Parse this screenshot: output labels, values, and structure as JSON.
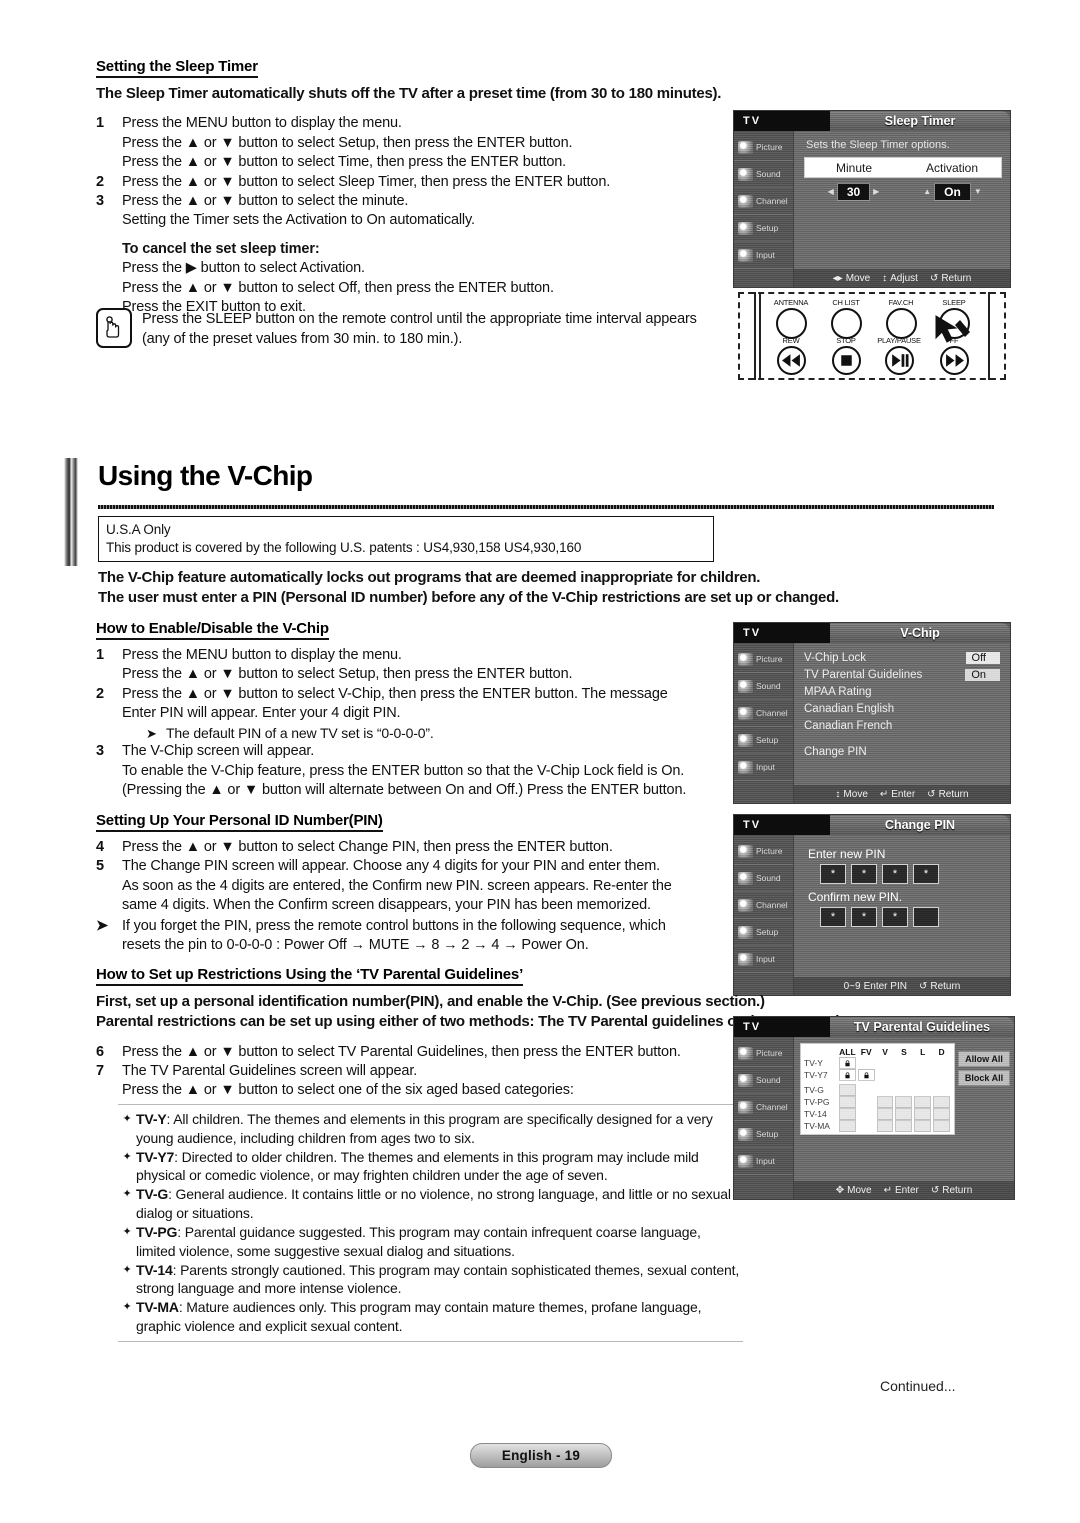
{
  "sleep_timer": {
    "heading": "Setting the Sleep Timer",
    "lead": "The Sleep Timer automatically shuts off the TV after a preset time (from 30 to 180 minutes).",
    "steps": [
      {
        "num": "1",
        "lines": [
          "Press the MENU button to display the menu.",
          "Press the ▲ or ▼ button to select Setup, then press the ENTER button.",
          "Press the ▲ or ▼ button to select Time, then press the ENTER button."
        ]
      },
      {
        "num": "2",
        "lines": [
          "Press the ▲ or ▼ button to select Sleep Timer, then press the ENTER button."
        ]
      },
      {
        "num": "3",
        "lines": [
          "Press the ▲ or ▼ button to select the minute.",
          "Setting the Timer sets the Activation to On automatically."
        ]
      }
    ],
    "cancel_heading": "To cancel the set sleep timer:",
    "cancel_lines": [
      "Press the ▶ button to select Activation.",
      "Press the ▲ or ▼ button to select Off, then press the ENTER button.",
      "Press the EXIT button to exit."
    ],
    "note_line1": "Press the SLEEP button on the remote control until the appropriate time interval appears",
    "note_line2": "(any of the preset values from 30 min. to 180 min.)."
  },
  "vchip": {
    "title": "Using the V-Chip",
    "patent_line1": "U.S.A Only",
    "patent_line2": "This product is covered by the following U.S. patents : US4,930,158 US4,930,160",
    "lead_line1": "The V-Chip feature automatically locks out programs that are deemed inappropriate for children.",
    "lead_line2": "The user must enter a PIN (Personal ID number) before any of the V-Chip restrictions are set up or changed."
  },
  "enable": {
    "heading": "How to Enable/Disable the V-Chip",
    "steps": [
      {
        "num": "1",
        "lines": [
          "Press the MENU button to display the menu.",
          "Press the ▲ or ▼ button to select Setup, then press the ENTER button."
        ]
      },
      {
        "num": "2",
        "lines": [
          "Press the ▲ or ▼ button to select V-Chip, then press the ENTER button. The message",
          "Enter PIN will appear. Enter your 4 digit PIN."
        ],
        "note": "The default PIN of a new TV set is “0-0-0-0”."
      },
      {
        "num": "3",
        "lines": [
          "The V-Chip screen will appear.",
          "To enable the V-Chip feature, press the ENTER button so that the V-Chip Lock field is On.",
          "(Pressing the ▲ or ▼ button will alternate between On and Off.) Press the ENTER button."
        ]
      }
    ]
  },
  "pin": {
    "heading": "Setting Up Your Personal ID Number(PIN)",
    "steps": [
      {
        "num": "4",
        "lines": [
          "Press the ▲ or ▼ button to select Change PIN, then press the ENTER button."
        ]
      },
      {
        "num": "5",
        "lines": [
          "The Change PIN screen will appear. Choose any 4 digits for your PIN and enter them.",
          "As soon as the 4 digits are entered, the Confirm new PIN. screen appears. Re-enter the",
          "same 4 digits. When the Confirm screen disappears, your PIN has been memorized."
        ]
      }
    ],
    "note_line1": "If you forget the PIN, press the remote control buttons in the following sequence, which",
    "note_line2": "resets the pin to 0-0-0-0 : Power Off → MUTE → 8 → 2 → 4 → Power On."
  },
  "restrictions": {
    "heading": "How to Set up Restrictions Using the ‘TV Parental Guidelines’",
    "lead_line1": "First, set up a personal identification number(PIN), and enable the V-Chip. (See previous section.)",
    "lead_line2": "Parental restrictions can be set up using either of two methods: The TV Parental guidelines or the MPAA rating.",
    "steps": [
      {
        "num": "6",
        "lines": [
          "Press the ▲ or ▼ button to select TV Parental Guidelines, then press the ENTER button."
        ]
      },
      {
        "num": "7",
        "lines": [
          "The TV Parental Guidelines screen will appear.",
          "Press the ▲ or ▼ button to select one of the six aged based categories:"
        ]
      }
    ],
    "ratings": [
      {
        "code": "TV-Y",
        "text": ": All children. The themes and elements in this program are specifically designed for a very young audience, including children from ages two to six."
      },
      {
        "code": "TV-Y7",
        "text": ": Directed to older children. The themes and elements in this program may include mild physical or comedic violence, or may frighten children under the age of seven."
      },
      {
        "code": "TV-G",
        "text": ": General audience. It contains little or no violence, no strong language, and little or no sexual dialog or situations."
      },
      {
        "code": "TV-PG",
        "text": ": Parental guidance suggested. This program may contain infrequent coarse language, limited violence, some suggestive sexual dialog and situations."
      },
      {
        "code": "TV-14",
        "text": ": Parents strongly cautioned. This program may contain sophisticated themes, sexual content, strong language and more intense violence."
      },
      {
        "code": "TV-MA",
        "text": ": Mature audiences only. This program may contain mature themes, profane language, graphic violence and explicit sexual content."
      }
    ]
  },
  "osd_common": {
    "tv_label": "TV",
    "side_items": [
      "Picture",
      "Sound",
      "Channel",
      "Setup",
      "Input"
    ],
    "move": "Move",
    "adjust": "Adjust",
    "enter": "Enter",
    "return": "Return"
  },
  "osd_sleep": {
    "title": "Sleep Timer",
    "description": "Sets the Sleep Timer options.",
    "col_minute": "Minute",
    "col_activation": "Activation",
    "minute_value": "30",
    "activation_value": "On"
  },
  "osd_vchip": {
    "title": "V-Chip",
    "rows": [
      {
        "label": "V-Chip Lock",
        "value": "Off"
      },
      {
        "label": "TV Parental Guidelines",
        "value": "On"
      },
      {
        "label": "MPAA Rating",
        "value": ""
      },
      {
        "label": "Canadian English",
        "value": ""
      },
      {
        "label": "Canadian French",
        "value": ""
      }
    ],
    "change_pin": "Change PIN"
  },
  "osd_pin": {
    "title": "Change PIN",
    "enter_label": "Enter new PIN",
    "confirm_label": "Confirm new PIN.",
    "digits": [
      "*",
      "*",
      "*",
      "*"
    ],
    "foot_enter": "Enter PIN",
    "foot_numeric": "0~9"
  },
  "osd_tvpg": {
    "title": "TV Parental Guidelines",
    "columns": [
      "ALL",
      "FV",
      "V",
      "S",
      "L",
      "D"
    ],
    "rows": [
      {
        "label": "TV-Y",
        "cells": [
          "lock",
          "off",
          "off",
          "off",
          "off",
          "off"
        ]
      },
      {
        "label": "TV-Y7",
        "cells": [
          "lock",
          "lock",
          "off",
          "off",
          "off",
          "off"
        ]
      },
      {
        "label": "TV-G",
        "cells": [
          "open",
          "off",
          "off",
          "off",
          "off",
          "off"
        ]
      },
      {
        "label": "TV-PG",
        "cells": [
          "open",
          "off",
          "open",
          "open",
          "open",
          "open"
        ]
      },
      {
        "label": "TV-14",
        "cells": [
          "open",
          "off",
          "open",
          "open",
          "open",
          "open"
        ]
      },
      {
        "label": "TV-MA",
        "cells": [
          "open",
          "off",
          "open",
          "open",
          "open",
          "open"
        ]
      }
    ],
    "allow_all": "Allow All",
    "block_all": "Block All"
  },
  "remote": {
    "top_buttons": [
      "ANTENNA",
      "CH LIST",
      "FAV.CH",
      "SLEEP"
    ],
    "bottom_buttons": [
      "REW",
      "STOP",
      "PLAY/PAUSE",
      "FF"
    ]
  },
  "footer": {
    "continued": "Continued...",
    "page_badge": "English - 19"
  }
}
